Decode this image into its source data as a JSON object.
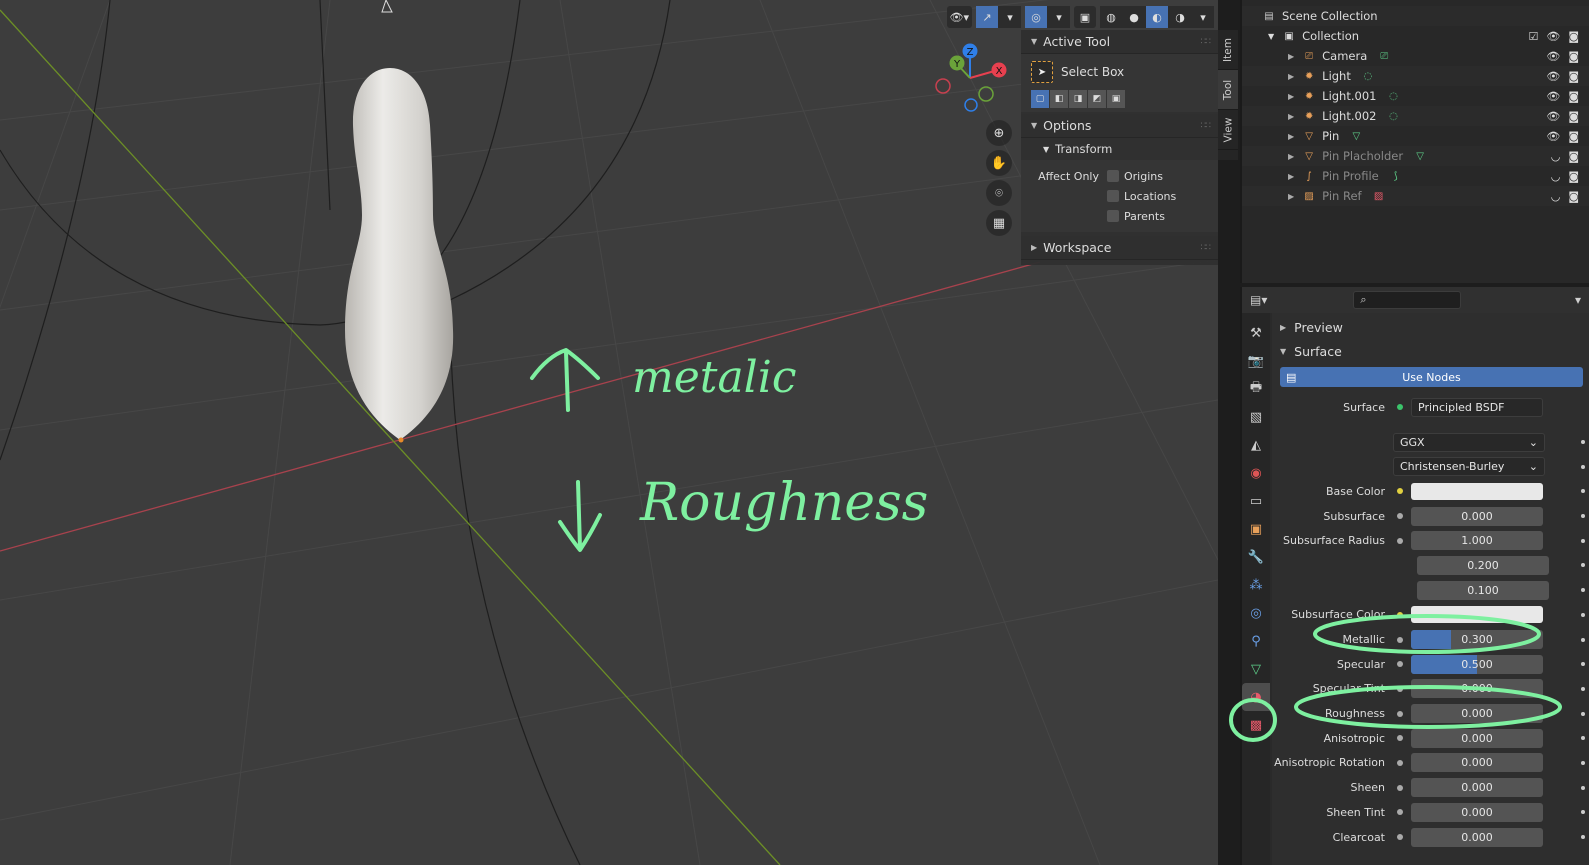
{
  "viewport": {
    "annotations": {
      "metallic_note": "metalic",
      "roughness_note": "Roughness"
    },
    "tabs": [
      "Item",
      "Tool",
      "View"
    ],
    "active_tab": "Tool",
    "gizmo": {
      "z": "Z",
      "y": "Y",
      "x": "X"
    }
  },
  "npanel": {
    "active_tool": {
      "title": "Active Tool",
      "tool_name": "Select Box"
    },
    "options": {
      "title": "Options",
      "transform": "Transform",
      "affect_only": "Affect Only",
      "checks": [
        "Origins",
        "Locations",
        "Parents"
      ]
    },
    "workspace": "Workspace"
  },
  "outliner": {
    "scene": "Scene Collection",
    "collection": "Collection",
    "items": [
      {
        "label": "Camera",
        "icon": "camera-icon",
        "color": "#e8a05a",
        "data_icon": "camera-data-icon",
        "dim": false
      },
      {
        "label": "Light",
        "icon": "light-icon",
        "color": "#e8a05a",
        "data_icon": "light-data-icon",
        "dim": false
      },
      {
        "label": "Light.001",
        "icon": "light-icon",
        "color": "#e8a05a",
        "data_icon": "light-data-icon",
        "dim": false
      },
      {
        "label": "Light.002",
        "icon": "light-icon",
        "color": "#e8a05a",
        "data_icon": "light-data-icon",
        "dim": false
      },
      {
        "label": "Pin",
        "icon": "mesh-icon",
        "color": "#e8a05a",
        "data_icon": "mesh-data-icon",
        "dim": false
      },
      {
        "label": "Pin Placholder",
        "icon": "mesh-icon",
        "color": "#e8a05a",
        "data_icon": "mesh-data-icon",
        "dim": true
      },
      {
        "label": "Pin Profile",
        "icon": "curve-icon",
        "color": "#e8a05a",
        "data_icon": "curve-data-icon",
        "dim": true
      },
      {
        "label": "Pin Ref",
        "icon": "image-icon",
        "color": "#e8a05a",
        "data_icon": "image-data-icon",
        "dim": true
      }
    ]
  },
  "properties": {
    "search_placeholder": "",
    "sections": {
      "preview": "Preview",
      "surface": "Surface"
    },
    "use_nodes": "Use Nodes",
    "surface_label": "Surface",
    "surface_shader": "Principled BSDF",
    "distribution": "GGX",
    "subsurface_method": "Christensen-Burley",
    "base_color": {
      "label": "Base Color",
      "color": "#e8e8e8"
    },
    "rows": [
      {
        "label": "Subsurface",
        "value": "0.000",
        "fill": 0
      },
      {
        "label": "Subsurface Radius",
        "value": "1.000",
        "fill": 0
      },
      {
        "label": "",
        "value": "0.200",
        "fill": 0
      },
      {
        "label": "",
        "value": "0.100",
        "fill": 0
      }
    ],
    "subsurface_color": {
      "label": "Subsurface Color",
      "color": "#e8e8e8"
    },
    "rows2": [
      {
        "label": "Metallic",
        "value": "0.300",
        "fill": 0.3
      },
      {
        "label": "Specular",
        "value": "0.500",
        "fill": 0.5
      },
      {
        "label": "Specular Tint",
        "value": "0.000",
        "fill": 0
      },
      {
        "label": "Roughness",
        "value": "0.000",
        "fill": 0
      },
      {
        "label": "Anisotropic",
        "value": "0.000",
        "fill": 0
      },
      {
        "label": "Anisotropic Rotation",
        "value": "0.000",
        "fill": 0
      },
      {
        "label": "Sheen",
        "value": "0.000",
        "fill": 0
      },
      {
        "label": "Sheen Tint",
        "value": "0.000",
        "fill": 0
      },
      {
        "label": "Clearcoat",
        "value": "0.000",
        "fill": 0
      }
    ]
  },
  "colors": {
    "accent": "#4772b3",
    "annotation": "#7ef0a0"
  }
}
